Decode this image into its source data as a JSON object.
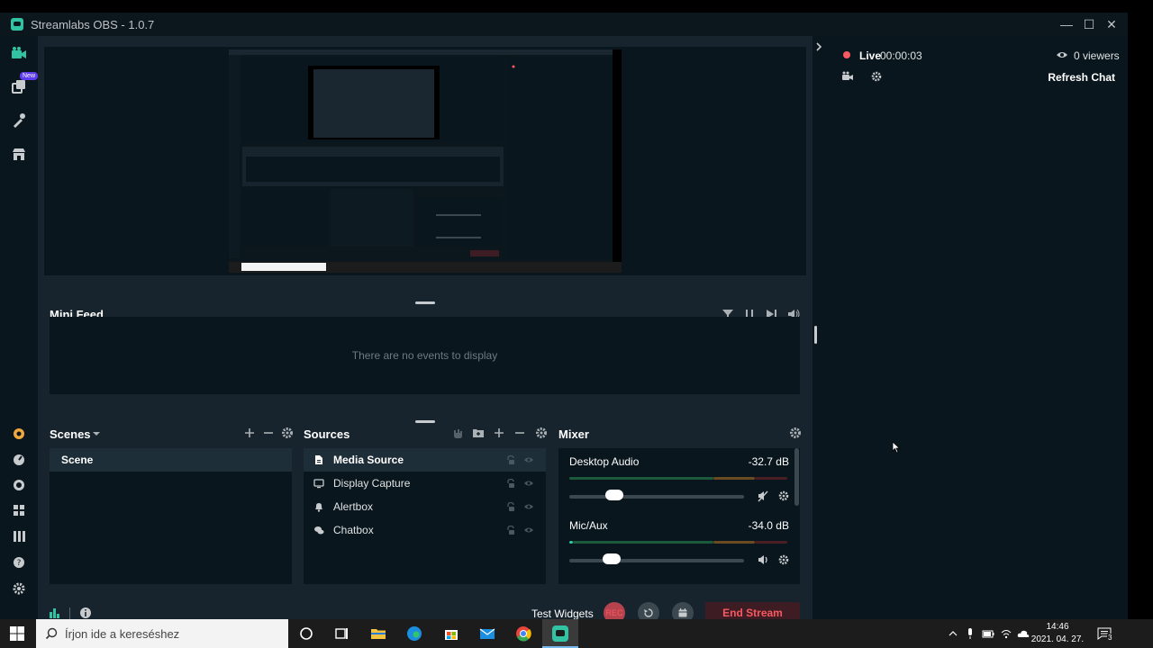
{
  "window": {
    "title": "Streamlabs OBS - 1.0.7"
  },
  "leftnav": {
    "new_badge": "New"
  },
  "minifeed": {
    "title": "Mini Feed",
    "empty_text": "There are no events to display"
  },
  "scenes": {
    "title": "Scenes",
    "items": [
      "Scene"
    ]
  },
  "sources": {
    "title": "Sources",
    "items": [
      {
        "label": "Media Source",
        "icon": "file-icon",
        "selected": true
      },
      {
        "label": "Display Capture",
        "icon": "monitor-icon"
      },
      {
        "label": "Alertbox",
        "icon": "bell-icon"
      },
      {
        "label": "Chatbox",
        "icon": "chat-bubbles-icon"
      }
    ]
  },
  "mixer": {
    "title": "Mixer",
    "channels": [
      {
        "name": "Desktop Audio",
        "level": "-32.7 dB",
        "volume": 0.26,
        "muted": true
      },
      {
        "name": "Mic/Aux",
        "level": "-34.0 dB",
        "volume": 0.24,
        "muted": false
      }
    ]
  },
  "footer": {
    "test_widgets": "Test Widgets",
    "rec": "REC",
    "end_stream": "End Stream"
  },
  "chat": {
    "live_label": "Live",
    "live_time": "00:00:03",
    "viewers": "0 viewers",
    "refresh": "Refresh Chat"
  },
  "taskbar": {
    "search_placeholder": "Írjon ide a kereséshez",
    "time": "14:46",
    "date": "2021. 04. 27.",
    "notifications": "3"
  },
  "colors": {
    "accent": "#31c3a2",
    "live": "#f85961",
    "end_stream_bg": "#3e1c23"
  }
}
